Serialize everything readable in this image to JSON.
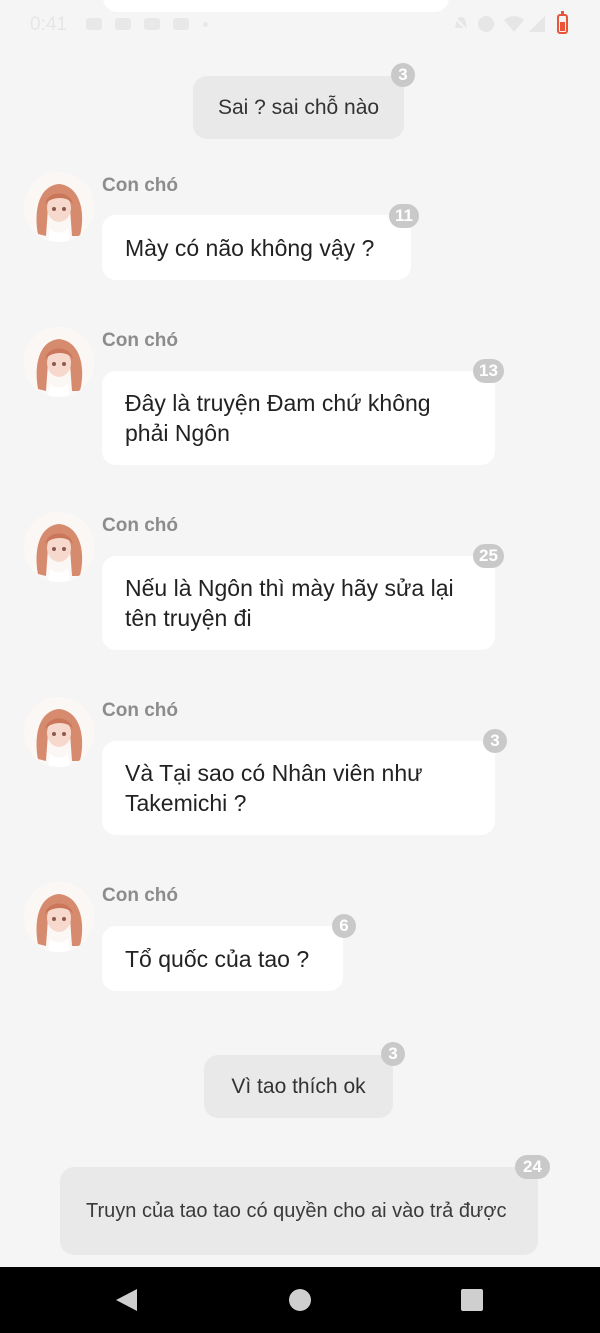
{
  "status_bar": {
    "time": "0:41"
  },
  "messages": [
    {
      "kind": "center",
      "text": "Sai ? sai chỗ nào",
      "badge": "3"
    },
    {
      "kind": "incoming",
      "sender": "Con chó",
      "text": "Mày có não không vậy ?",
      "badge": "11"
    },
    {
      "kind": "incoming",
      "sender": "Con chó",
      "text": "Đây là truyện Đam chứ không phải Ngôn",
      "badge": "13"
    },
    {
      "kind": "incoming",
      "sender": "Con chó",
      "text": "Nếu là Ngôn thì mày hãy sửa lại tên truyện đi",
      "badge": "25"
    },
    {
      "kind": "incoming",
      "sender": "Con chó",
      "text": "Và Tại sao có Nhân viên như Takemichi ?",
      "badge": "3"
    },
    {
      "kind": "incoming",
      "sender": "Con chó",
      "text": "Tổ quốc của tao ?",
      "badge": "6"
    },
    {
      "kind": "center",
      "text": "Vì tao thích ok",
      "badge": "3"
    },
    {
      "kind": "outgoing",
      "text": "Truyn của tao tao có quyền cho ai vào trả được",
      "badge": "24"
    }
  ],
  "nav_bar": {
    "icons": [
      "back-icon",
      "home-icon",
      "recents-icon"
    ]
  },
  "colors": {
    "background": "#f5f5f5",
    "bubble_incoming": "#ffffff",
    "bubble_center": "#e9e9e9",
    "badge": "#c9c9c9",
    "sender": "#8c8c8c",
    "battery": "#e8553a"
  }
}
